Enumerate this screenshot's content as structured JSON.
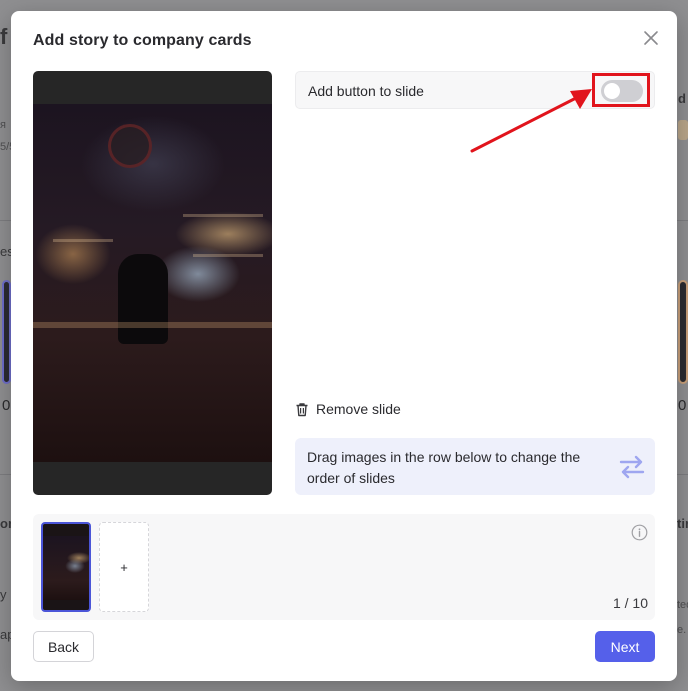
{
  "background": {
    "fragments": [
      "f",
      "я",
      "5/5",
      "es",
      "d",
      "0",
      "0",
      "on",
      "y",
      "ap",
      "tir",
      "ted",
      "e."
    ]
  },
  "modal": {
    "title": "Add story to company cards",
    "close_icon": "close-icon"
  },
  "toggle_row": {
    "label": "Add button to slide",
    "enabled": false
  },
  "remove_slide": {
    "label": "Remove slide",
    "icon": "trash-icon"
  },
  "hint": {
    "text": "Drag images in the row below to change the order of slides",
    "icon": "swap-arrows-icon"
  },
  "slides": {
    "add_label": "+",
    "counter": "1 / 10",
    "info_icon": "info-icon"
  },
  "footer": {
    "back_label": "Back",
    "next_label": "Next"
  },
  "colors": {
    "accent": "#5560ea",
    "highlight": "#e1141c",
    "hint_bg": "#eef0fb"
  }
}
